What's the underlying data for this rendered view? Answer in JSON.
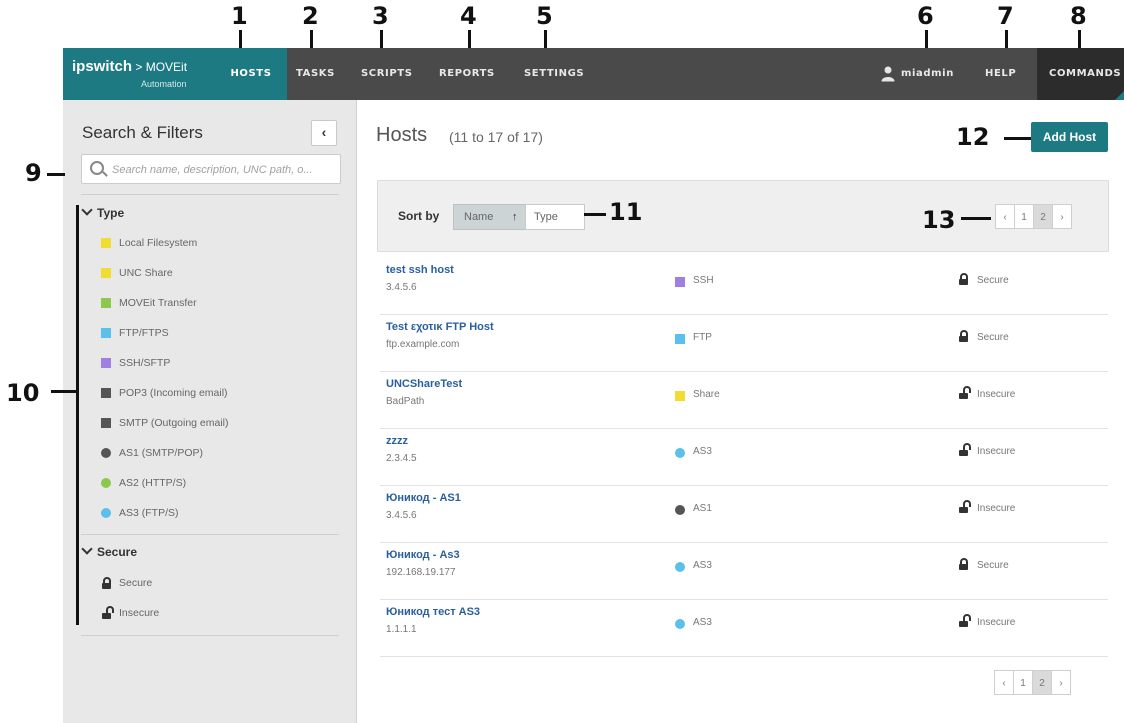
{
  "callouts": {
    "n1": "1",
    "n2": "2",
    "n3": "3",
    "n4": "4",
    "n5": "5",
    "n6": "6",
    "n7": "7",
    "n8": "8",
    "n9": "9",
    "n10": "10",
    "n11": "11",
    "n12": "12",
    "n13": "13"
  },
  "topbar": {
    "brand_line1": "ipswitch",
    "brand_line1b": " > MOVEit",
    "brand_line2": "Automation",
    "nav": [
      "HOSTS",
      "TASKS",
      "SCRIPTS",
      "REPORTS",
      "SETTINGS"
    ],
    "user": "miadmin",
    "help": "HELP",
    "commands": "COMMANDS",
    "colors": {
      "bar": "#4a4a4a",
      "accent": "#1e7a82",
      "commands_bg": "#2c2c2c"
    }
  },
  "sidebar": {
    "title": "Search & Filters",
    "collapse_icon": "chevron-left-icon",
    "search_placeholder": "Search name, description, UNC path, o...",
    "type_header": "Type",
    "type_filters": [
      {
        "label": "Local Filesystem",
        "color": "#f2dc32",
        "shape": "square"
      },
      {
        "label": "UNC Share",
        "color": "#f2dc32",
        "shape": "square"
      },
      {
        "label": "MOVEit Transfer",
        "color": "#8cc84b",
        "shape": "square"
      },
      {
        "label": "FTP/FTPS",
        "color": "#5bc0eb",
        "shape": "square"
      },
      {
        "label": "SSH/SFTP",
        "color": "#9f7fe0",
        "shape": "square"
      },
      {
        "label": "POP3 (Incoming email)",
        "color": "#555555",
        "shape": "square"
      },
      {
        "label": "SMTP (Outgoing email)",
        "color": "#555555",
        "shape": "square"
      },
      {
        "label": "AS1 (SMTP/POP)",
        "color": "#555555",
        "shape": "circle"
      },
      {
        "label": "AS2 (HTTP/S)",
        "color": "#8cc84b",
        "shape": "circle"
      },
      {
        "label": "AS3 (FTP/S)",
        "color": "#5bc0eb",
        "shape": "circle"
      }
    ],
    "secure_header": "Secure",
    "secure_filters": [
      {
        "label": "Secure",
        "icon": "lock-icon"
      },
      {
        "label": "Insecure",
        "icon": "unlock-icon"
      }
    ]
  },
  "main": {
    "title": "Hosts",
    "subtitle": "(11 to 17 of 17)",
    "add_button": "Add Host",
    "sort_label": "Sort by",
    "sort_name": "Name",
    "sort_name_icon": "arrow-up-icon",
    "sort_type": "Type",
    "pager": {
      "prev": "‹",
      "pages": [
        "1",
        "2"
      ],
      "current": "2",
      "next": "›"
    },
    "hosts": [
      {
        "name": "test ssh host",
        "address": "3.4.5.6",
        "type": "SSH",
        "type_color": "#9f7fe0",
        "type_shape": "square",
        "security": "Secure",
        "lock": "closed"
      },
      {
        "name": "Test εχοτικ FTP Host",
        "address": "ftp.example.com",
        "type": "FTP",
        "type_color": "#5bc0eb",
        "type_shape": "square",
        "security": "Secure",
        "lock": "closed"
      },
      {
        "name": "UNCShareTest",
        "address": "BadPath",
        "type": "Share",
        "type_color": "#f2dc32",
        "type_shape": "square",
        "security": "Insecure",
        "lock": "open"
      },
      {
        "name": "zzzz",
        "address": "2.3.4.5",
        "type": "AS3",
        "type_color": "#5bc0eb",
        "type_shape": "circle",
        "security": "Insecure",
        "lock": "open"
      },
      {
        "name": "Юникод - AS1",
        "address": "3.4.5.6",
        "type": "AS1",
        "type_color": "#555555",
        "type_shape": "circle",
        "security": "Insecure",
        "lock": "open"
      },
      {
        "name": "Юникод - As3",
        "address": "192.168.19.177",
        "type": "AS3",
        "type_color": "#5bc0eb",
        "type_shape": "circle",
        "security": "Secure",
        "lock": "closed"
      },
      {
        "name": "Юникод тест AS3",
        "address": "1.1.1.1",
        "type": "AS3",
        "type_color": "#5bc0eb",
        "type_shape": "circle",
        "security": "Insecure",
        "lock": "open"
      }
    ]
  }
}
